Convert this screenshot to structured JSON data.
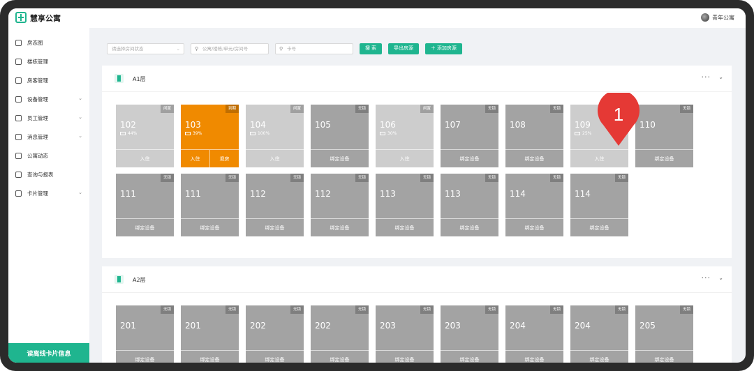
{
  "app": {
    "title": "慧享公寓",
    "user_name": "青年公寓"
  },
  "sidebar": {
    "items": [
      {
        "label": "房态图",
        "has_arrow": false
      },
      {
        "label": "楼栋管理",
        "has_arrow": false
      },
      {
        "label": "房客管理",
        "has_arrow": false
      },
      {
        "label": "设备管理",
        "has_arrow": true
      },
      {
        "label": "员工管理",
        "has_arrow": true
      },
      {
        "label": "消息管理",
        "has_arrow": true
      },
      {
        "label": "公寓动态",
        "has_arrow": false
      },
      {
        "label": "查询与报表",
        "has_arrow": false
      },
      {
        "label": "卡片管理",
        "has_arrow": true
      }
    ],
    "read_card_button": "读离线卡片信息"
  },
  "filters": {
    "status_placeholder": "请选择房间状态",
    "search_placeholder": "公寓/楼栋/单元/房间号",
    "card_placeholder": "卡号",
    "search_button": "搜 索",
    "export_button": "导出房源",
    "add_button": "添加房源"
  },
  "floors": [
    {
      "title": "A1层",
      "rooms": [
        {
          "number": "102",
          "status": "闲置",
          "battery": "44%",
          "action": "入住",
          "style": "light"
        },
        {
          "number": "103",
          "status": "到期",
          "battery": "39%",
          "actions": [
            "入住",
            "退房"
          ],
          "style": "orange"
        },
        {
          "number": "104",
          "status": "闲置",
          "battery": "100%",
          "action": "入住",
          "style": "light"
        },
        {
          "number": "105",
          "status": "无锁",
          "action": "绑定设备",
          "style": "dark"
        },
        {
          "number": "106",
          "status": "闲置",
          "battery": "30%",
          "action": "入住",
          "style": "light"
        },
        {
          "number": "107",
          "status": "无锁",
          "action": "绑定设备",
          "style": "dark"
        },
        {
          "number": "108",
          "status": "无锁",
          "action": "绑定设备",
          "style": "dark"
        },
        {
          "number": "109",
          "status": "闲置",
          "battery": "25%",
          "action": "入住",
          "style": "light"
        },
        {
          "number": "110",
          "status": "无锁",
          "action": "绑定设备",
          "style": "dark"
        },
        {
          "number": "111",
          "status": "无锁",
          "action": "绑定设备",
          "style": "dark"
        },
        {
          "number": "111",
          "status": "无锁",
          "action": "绑定设备",
          "style": "dark"
        },
        {
          "number": "112",
          "status": "无锁",
          "action": "绑定设备",
          "style": "dark"
        },
        {
          "number": "112",
          "status": "无锁",
          "action": "绑定设备",
          "style": "dark"
        },
        {
          "number": "113",
          "status": "无锁",
          "action": "绑定设备",
          "style": "dark"
        },
        {
          "number": "113",
          "status": "无锁",
          "action": "绑定设备",
          "style": "dark"
        },
        {
          "number": "114",
          "status": "无锁",
          "action": "绑定设备",
          "style": "dark"
        },
        {
          "number": "114",
          "status": "无锁",
          "action": "绑定设备",
          "style": "dark"
        }
      ]
    },
    {
      "title": "A2层",
      "rooms": [
        {
          "number": "201",
          "status": "无锁",
          "action": "绑定设备",
          "style": "dark"
        },
        {
          "number": "201",
          "status": "无锁",
          "action": "绑定设备",
          "style": "dark"
        },
        {
          "number": "202",
          "status": "无锁",
          "action": "绑定设备",
          "style": "dark"
        },
        {
          "number": "202",
          "status": "无锁",
          "action": "绑定设备",
          "style": "dark"
        },
        {
          "number": "203",
          "status": "无锁",
          "action": "绑定设备",
          "style": "dark"
        },
        {
          "number": "203",
          "status": "无锁",
          "action": "绑定设备",
          "style": "dark"
        },
        {
          "number": "204",
          "status": "无锁",
          "action": "绑定设备",
          "style": "dark"
        },
        {
          "number": "204",
          "status": "无锁",
          "action": "绑定设备",
          "style": "dark"
        },
        {
          "number": "205",
          "status": "无锁",
          "action": "绑定设备",
          "style": "dark"
        }
      ]
    }
  ],
  "annotation": {
    "number": "1",
    "color": "#e53935"
  },
  "colors": {
    "accent": "#1fb58f",
    "expired": "#f08a00",
    "idle": "#cdcdcd",
    "nolock": "#a3a3a3"
  }
}
